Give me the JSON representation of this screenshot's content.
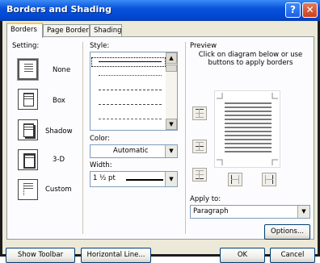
{
  "window": {
    "title": "Borders and Shading",
    "help_glyph": "?",
    "close_glyph": "✕"
  },
  "tabs": [
    {
      "label": "Borders",
      "accel": "B"
    },
    {
      "label": "Page Border",
      "accel": "P"
    },
    {
      "label": "Shading",
      "accel": "S"
    }
  ],
  "setting": {
    "label": "Setting:",
    "options": [
      {
        "label": "None",
        "accel": "N",
        "selected": true
      },
      {
        "label": "Box",
        "accel": "x",
        "selected": false
      },
      {
        "label": "Shadow",
        "accel": "a",
        "selected": false
      },
      {
        "label": "3-D",
        "accel": "D",
        "selected": false
      },
      {
        "label": "Custom",
        "accel": "u",
        "selected": false
      }
    ]
  },
  "style": {
    "label": "Style:",
    "accel": "Y",
    "lines": [
      "solid",
      "dotted",
      "dashed",
      "dash-dot",
      "dash-dot-dot"
    ]
  },
  "color": {
    "label": "Color:",
    "value": "Automatic"
  },
  "width": {
    "label": "Width:",
    "value": "1 ½ pt"
  },
  "preview": {
    "label": "Preview",
    "instructions": "Click on diagram below or use buttons to apply borders"
  },
  "apply_to": {
    "label": "Apply to:",
    "value": "Paragraph"
  },
  "buttons": {
    "options": "Options...",
    "show_toolbar": "Show Toolbar",
    "horizontal_line": "Horizontal Line...",
    "ok": "OK",
    "cancel": "Cancel"
  }
}
